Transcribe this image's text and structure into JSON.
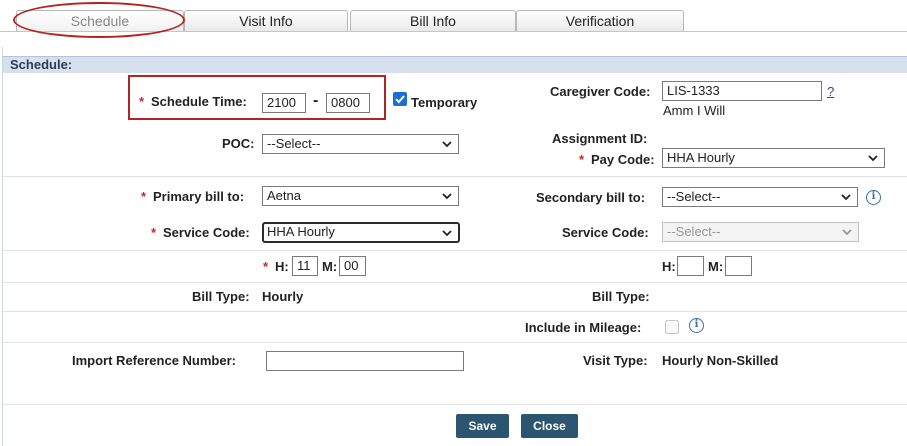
{
  "tabs": [
    {
      "label": "Schedule",
      "active": true
    },
    {
      "label": "Visit Info"
    },
    {
      "label": "Bill Info"
    },
    {
      "label": "Verification"
    }
  ],
  "section_title": "Schedule:",
  "required_mark": "*",
  "schedule_time": {
    "label": "Schedule Time:",
    "start": "2100",
    "separator": "-",
    "end": "0800"
  },
  "temporary": {
    "label": "Temporary",
    "checked": true
  },
  "caregiver_code": {
    "label": "Caregiver Code:",
    "value": "LIS-1333",
    "help": "?",
    "name": "Amm I Will"
  },
  "poc": {
    "label": "POC:",
    "value": "--Select--"
  },
  "assignment_id": {
    "label": "Assignment ID:"
  },
  "pay_code": {
    "label": "Pay Code:",
    "value": "HHA Hourly"
  },
  "primary_bill": {
    "label": "Primary bill to:",
    "value": "Aetna"
  },
  "secondary_bill": {
    "label": "Secondary bill to:",
    "value": "--Select--"
  },
  "service_code_left": {
    "label": "Service Code:",
    "value": "HHA Hourly"
  },
  "service_code_right": {
    "label": "Service Code:",
    "value": "--Select--"
  },
  "duration_left": {
    "h_label": "H:",
    "h": "11",
    "m_label": "M:",
    "m": "00"
  },
  "duration_right": {
    "h_label": "H:",
    "h": "",
    "m_label": "M:",
    "m": ""
  },
  "bill_type_left": {
    "label": "Bill Type:",
    "value": "Hourly"
  },
  "bill_type_right": {
    "label": "Bill Type:",
    "value": ""
  },
  "include_mileage": {
    "label": "Include in Mileage:",
    "checked": false
  },
  "import_ref": {
    "label": "Import Reference Number:",
    "value": ""
  },
  "visit_type": {
    "label": "Visit Type:",
    "value": "Hourly Non-Skilled"
  },
  "buttons": {
    "save": "Save",
    "close": "Close"
  },
  "info_icon": "i",
  "colors": {
    "accent_red": "#b42323",
    "section_bar": "#d6e0ee",
    "button": "#2b5570",
    "checkbox_blue": "#1a6fd1"
  }
}
